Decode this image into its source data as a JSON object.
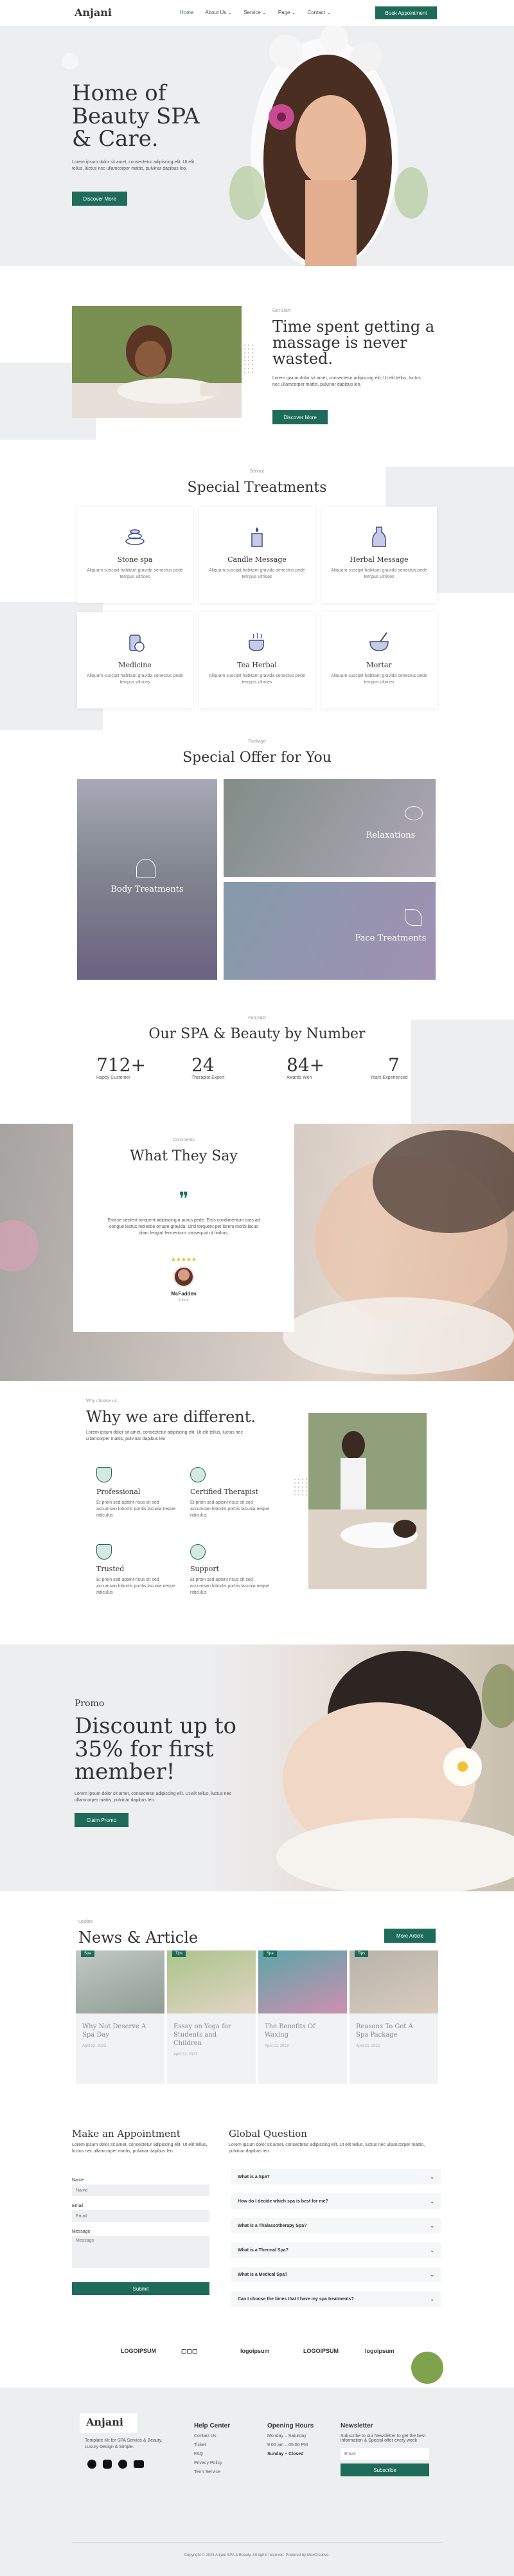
{
  "brand": {
    "name": "Anjani",
    "accent": "#1f6b5a"
  },
  "nav": {
    "items": [
      "Home",
      "About Us",
      "Service",
      "Page",
      "Contact"
    ],
    "cta": "Book Appointment"
  },
  "hero": {
    "title_l1": "Home of",
    "title_l2": "Beauty SPA",
    "title_l3": "& Care.",
    "text": "Lorem ipsum dolor sit amet, consectetur adipiscing elit. Ut elit tellus, luctus nec ullamcorper mattis, pulvinar dapibus leo.",
    "button": "Discover More"
  },
  "about": {
    "label": "Get Start",
    "title_l1": "Time spent getting a",
    "title_l2": "massage is never",
    "title_l3": "wasted.",
    "text": "Lorem ipsum dolor sit amet, consectetur adipiscing elit. Ut elit tellus, luctus nec ullamcorper mattis, pulvinar dapibus leo.",
    "button": "Discover More"
  },
  "treatments": {
    "label": "Service",
    "title": "Special Treatments",
    "items": [
      {
        "title": "Stone spa",
        "text": "Aliquam suscipit habitant gravida senectus pede tempus ultrices"
      },
      {
        "title": "Candle Message",
        "text": "Aliquam suscipit habitant gravida senectus pede tempus ultrices"
      },
      {
        "title": "Herbal Message",
        "text": "Aliquam suscipit habitant gravida senectus pede tempus ultrices"
      },
      {
        "title": "Medicine",
        "text": "Aliquam suscipit habitant gravida senectus pede tempus ultrices"
      },
      {
        "title": "Tea Herbal",
        "text": "Aliquam suscipit habitant gravida senectus pede tempus ultrices"
      },
      {
        "title": "Mortar",
        "text": "Aliquam suscipit habitant gravida senectus pede tempus ultrices"
      }
    ]
  },
  "offer": {
    "label": "Package",
    "title": "Special Offer for You",
    "items": [
      "Body Treatments",
      "Relaxations",
      "Face Treatments"
    ]
  },
  "numbers": {
    "label": "Fun Fact",
    "title": "Our SPA & Beauty by Number",
    "items": [
      {
        "value": "712+",
        "label": "Happy Customer"
      },
      {
        "value": "24",
        "label": "Therapist Expert"
      },
      {
        "value": "84+",
        "label": "Awards Won"
      },
      {
        "value": "7",
        "label": "Years Experienced"
      }
    ]
  },
  "testimonial": {
    "label": "Comments",
    "title": "What They Say",
    "quote_mark": "❞",
    "text": "Erat se sectent torquent adipiscing a purus pede. Eros condimentum cras ad congue lectus molestie ornare gravida. Orci torquent per lorem morbi lacus diam feugiat fermentum consequat ut finibus.",
    "stars": "★★★★★",
    "name": "McFadden",
    "role": "Client"
  },
  "different": {
    "label": "Why choose us",
    "title": "Why we are different.",
    "text": "Lorem ipsum dolor sit amet, consectetur adipiscing elit. Ut elit tellus, luctus nec ullamcorper mattis, pulvinar dapibus leo.",
    "items": [
      {
        "title": "Professional",
        "text": "Et proin sed aptent risus sit sed accumsan lobortis porttis lacunia neque ridiculus"
      },
      {
        "title": "Certified Therapist",
        "text": "Et proin sed aptent risus sit sed accumsan lobortis porttis lacunia neque ridiculus"
      },
      {
        "title": "Trusted",
        "text": "Et proin sed aptent risus sit sed accumsan lobortis porttis lacunia neque ridiculus"
      },
      {
        "title": "Support",
        "text": "Et proin sed aptent risus sit sed accumsan lobortis porttis lacunia neque ridiculus"
      }
    ]
  },
  "promo": {
    "label": "Promo",
    "title_l1": "Discount up to",
    "title_l2": "35% for first",
    "title_l3": "member!",
    "text": "Lorem ipsum dolor sit amet, consectetur adipiscing elit. Ut elit tellus, luctus nec ullamcorper mattis, pulvinar dapibus leo.",
    "button": "Claim Promo"
  },
  "news": {
    "label": "Update",
    "title": "News & Article",
    "button": "More Article",
    "items": [
      {
        "tag": "Spa",
        "title": "Why Not Deserve A Spa Day",
        "date": "April 22, 2023"
      },
      {
        "tag": "Tips",
        "title": "Essay on Yoga for Students and Children",
        "date": "April 22, 2023"
      },
      {
        "tag": "Spa",
        "title": "The Benefits Of Waxing",
        "date": "April 22, 2023"
      },
      {
        "tag": "Tips",
        "title": "Reasons To Get A Spa Package",
        "date": "April 22, 2023"
      }
    ]
  },
  "appointment": {
    "title": "Make an Appointment",
    "text": "Lorem ipsum dolor sit amet, consectetur adipiscing elit. Ut elit tellus, luctus nec ullamcorper mattis, pulvinar dapibus leo.",
    "name_label": "Name",
    "name_placeholder": "Name",
    "email_label": "Email",
    "email_placeholder": "Email",
    "message_label": "Message",
    "message_placeholder": "Message",
    "submit": "Submit"
  },
  "faq": {
    "title": "Global Question",
    "text": "Lorem ipsum dolor sit amet, consectetur adipiscing elit. Ut elit tellus, luctus nec ullamcorper mattis, pulvinar dapibus leo.",
    "items": [
      "What is a Spa?",
      "How do I decide which spa is best for me?",
      "What is a Thalassotherapy Spa?",
      "What is a Thermal Spa?",
      "What is a Medical Spa?",
      "Can I choose the times that I have my spa treatments?"
    ]
  },
  "logos": [
    "LOGOIPSUM",
    "logoipsum",
    "LOGOIPSUM",
    "logoipsum"
  ],
  "footer": {
    "brand": "Anjani",
    "tagline": "Template Kit for SPA Service & Beauty. Luxury Design & Simple.",
    "help_title": "Help Center",
    "help_items": [
      "Contact Us",
      "Ticket",
      "FAQ",
      "Privacy Policy",
      "Term Service"
    ],
    "hours_title": "Opening Hours",
    "hours": [
      "Monday – Saturday",
      "9:00 am – 05:00 PM",
      "Sunday – Closed"
    ],
    "newsletter_title": "Newsletter",
    "newsletter_text": "Subscribe to our Newsletter to get the best information & Special offer every week",
    "newsletter_placeholder": "Email",
    "subscribe": "Subscribe",
    "copyright": "Copyright © 2023 Anjani SPA & Beauty. All rights reserved. Powered by MoxCreative."
  }
}
